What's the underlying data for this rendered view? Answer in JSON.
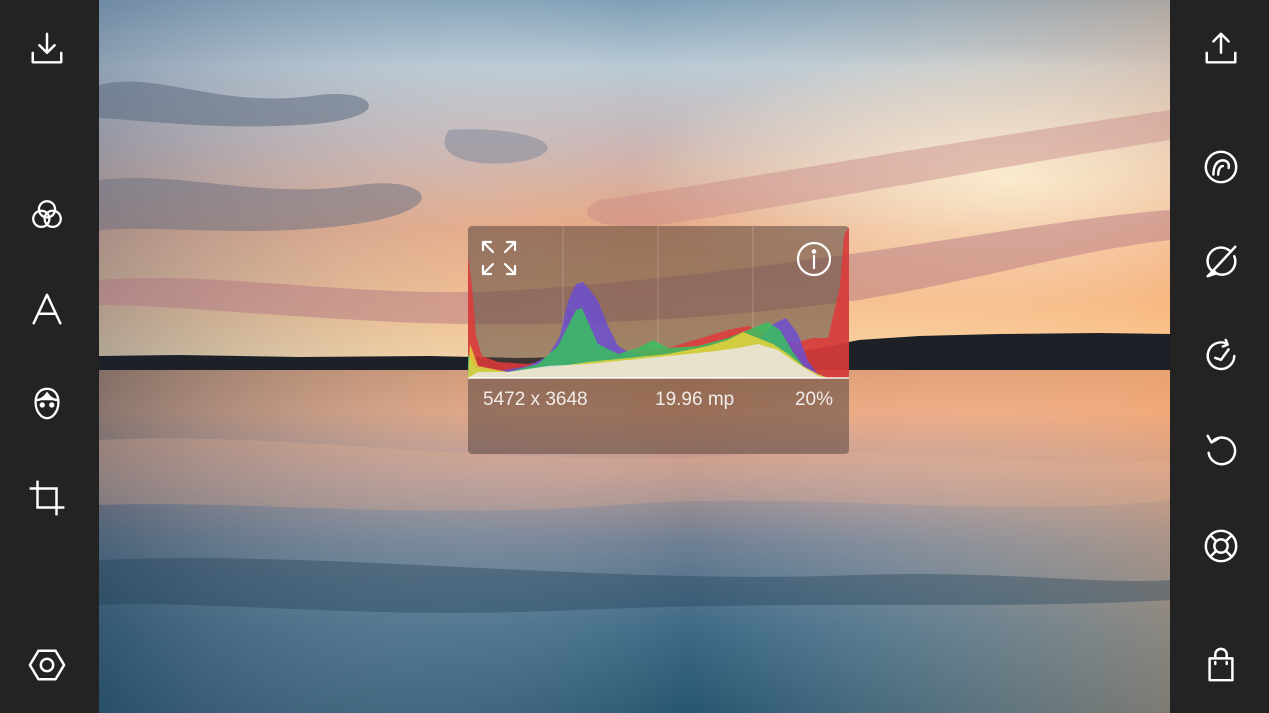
{
  "left_toolbar": {
    "items": [
      {
        "name": "download",
        "icon": "download-icon"
      },
      {
        "name": "filters",
        "icon": "filters-icon"
      },
      {
        "name": "text",
        "icon": "text-icon"
      },
      {
        "name": "face",
        "icon": "face-icon"
      },
      {
        "name": "crop",
        "icon": "crop-icon"
      },
      {
        "name": "settings",
        "icon": "hexagon-settings-icon"
      }
    ]
  },
  "right_toolbar": {
    "items": [
      {
        "name": "share",
        "icon": "share-icon"
      },
      {
        "name": "looks",
        "icon": "looks-swirl-icon"
      },
      {
        "name": "brush",
        "icon": "brush-eraser-icon"
      },
      {
        "name": "history",
        "icon": "history-icon"
      },
      {
        "name": "undo",
        "icon": "undo-icon"
      },
      {
        "name": "help",
        "icon": "lifebuoy-icon"
      },
      {
        "name": "shop",
        "icon": "shopping-bag-icon"
      }
    ]
  },
  "histogram": {
    "resolution": "5472 x 3648",
    "megapixels": "19.96 mp",
    "zoom": "20%",
    "channels": [
      {
        "name": "red",
        "color": "#e0393a"
      },
      {
        "name": "blue",
        "color": "#6b4fd0"
      },
      {
        "name": "green",
        "color": "#38c060"
      },
      {
        "name": "yellow",
        "color": "#e8d23a"
      },
      {
        "name": "luminance",
        "color": "#e8e4dc"
      }
    ]
  },
  "colors": {
    "toolbar_bg": "#232323",
    "icon": "#ffffff"
  }
}
